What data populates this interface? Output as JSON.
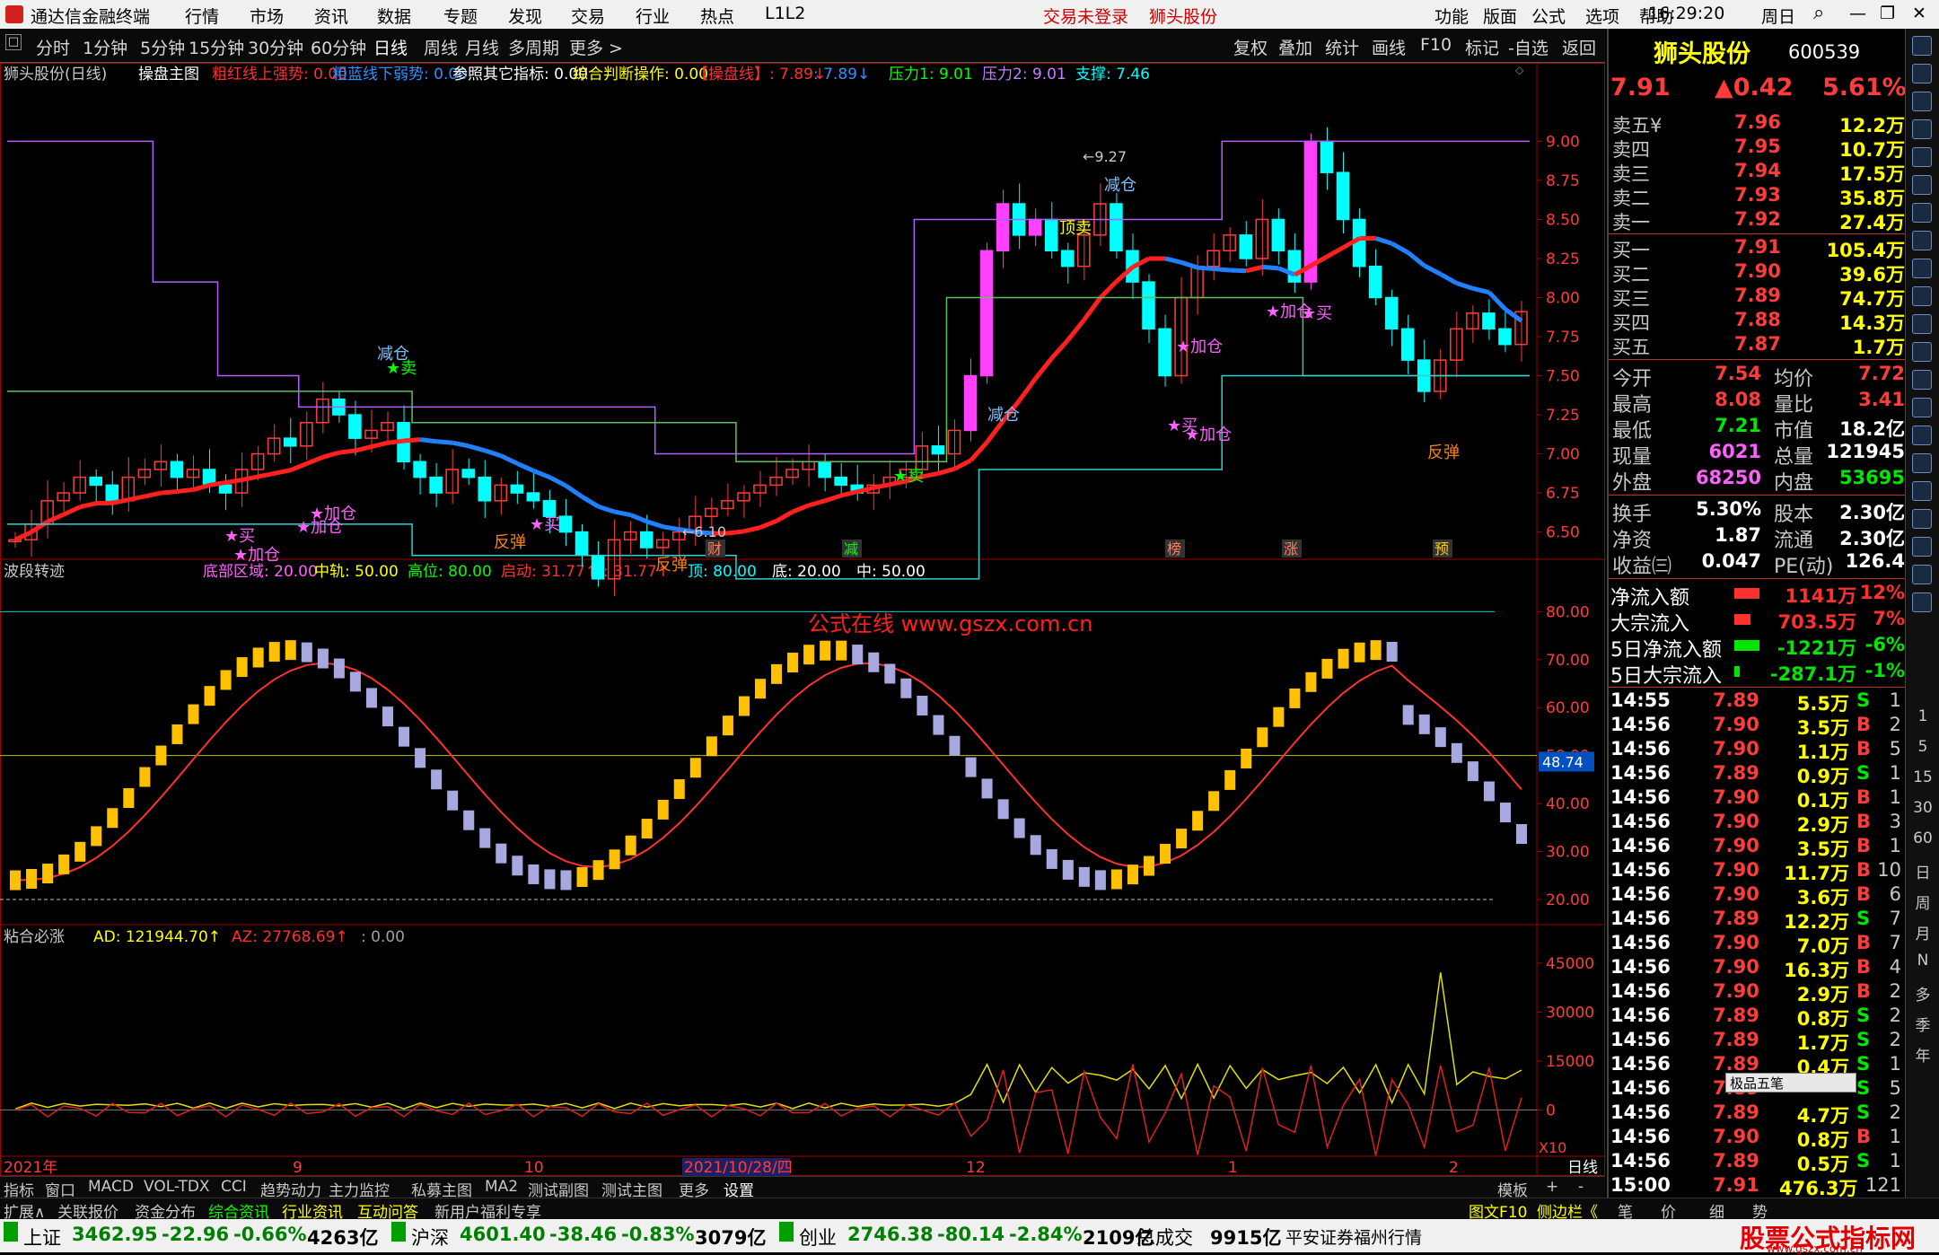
{
  "app": {
    "title": "通达信金融终端",
    "menu": [
      "行情",
      "市场",
      "资讯",
      "数据",
      "专题",
      "发现",
      "交易",
      "行业",
      "热点",
      "L1L2"
    ],
    "login": "交易未登录",
    "stock_name": "狮头股份",
    "right_menu": [
      "功能",
      "版面",
      "公式",
      "选项",
      "帮助"
    ],
    "time": "16:29:20",
    "weekday": "周日"
  },
  "toolbar": {
    "periods": [
      "分时",
      "1分钟",
      "5分钟",
      "15分钟",
      "30分钟",
      "60分钟",
      "日线",
      "周线",
      "月线",
      "多周期",
      "更多 >"
    ],
    "right": [
      "复权",
      "叠加",
      "统计",
      "画线",
      "F10",
      "标记",
      "-自选",
      "返回"
    ]
  },
  "main_panel": {
    "name": "狮头股份(日线)",
    "indicator": "操盘主图",
    "items": [
      {
        "t": "粗红线上强势: 0.00",
        "c": "#ff3030"
      },
      {
        "t": "粗蓝线下弱势: 0.00",
        "c": "#3090ff"
      },
      {
        "t": "参照其它指标: 0.00",
        "c": "#ffffff"
      },
      {
        "t": "综合判断操作: 0.00",
        "c": "#ffff00"
      },
      {
        "t": "【操盘线】: 7.89↓",
        "c": "#ff3030"
      },
      {
        "t": ": 7.89↓",
        "c": "#3090ff"
      },
      {
        "t": "压力1: 9.01",
        "c": "#00ff00"
      },
      {
        "t": "压力2: 9.01",
        "c": "#c080ff"
      },
      {
        "t": "支撑: 7.46",
        "c": "#00ffff"
      }
    ],
    "yticks": [
      "9.00",
      "8.75",
      "8.50",
      "8.25",
      "8.00",
      "7.75",
      "7.50",
      "7.25",
      "7.00",
      "6.75",
      "6.50"
    ],
    "high_label": "9.27",
    "low_label": "6.10",
    "signals": [
      {
        "t": "减仓",
        "c": "#80c0ff"
      },
      {
        "t": "★卖",
        "c": "#00ff00"
      },
      {
        "t": "减仓",
        "c": "#80c0ff"
      },
      {
        "t": "减仓",
        "c": "#80c0ff"
      },
      {
        "t": "顶卖",
        "c": "#ffff00"
      },
      {
        "t": "★卖",
        "c": "#00ff00"
      },
      {
        "t": "★买",
        "c": "#ff60ff"
      },
      {
        "t": "★加仓",
        "c": "#ff60ff"
      },
      {
        "t": "★加仓",
        "c": "#ff60ff"
      },
      {
        "t": "★加仓",
        "c": "#ff60ff"
      },
      {
        "t": "反弹",
        "c": "#ff8000"
      },
      {
        "t": "反弹",
        "c": "#ff8000"
      },
      {
        "t": "★买",
        "c": "#ff60ff"
      },
      {
        "t": "★加仓",
        "c": "#ff60ff"
      },
      {
        "t": "★买",
        "c": "#ff60ff"
      },
      {
        "t": "★加仓",
        "c": "#ff60ff"
      },
      {
        "t": "★加仓",
        "c": "#ff60ff"
      },
      {
        "t": "★买",
        "c": "#ff60ff"
      },
      {
        "t": "反弹",
        "c": "#ff8000"
      }
    ],
    "badges": [
      "财",
      "减",
      "榜",
      "涨",
      "预"
    ]
  },
  "wave_panel": {
    "name": "波段转迹",
    "items": [
      {
        "t": "底部区域: 20.00",
        "c": "#ff60ff"
      },
      {
        "t": "中轨: 50.00",
        "c": "#ffff00"
      },
      {
        "t": "高位: 80.00",
        "c": "#00ff00"
      },
      {
        "t": "启动: 31.77↑",
        "c": "#ff3030"
      },
      {
        "t": ": 31.77↑",
        "c": "#ff3030"
      },
      {
        "t": "顶: 80.00",
        "c": "#00ffff"
      },
      {
        "t": "底: 20.00",
        "c": "#ffffff"
      },
      {
        "t": "中: 50.00",
        "c": "#ffffff"
      }
    ],
    "yticks": [
      "80.00",
      "70.00",
      "60.00",
      "50.00",
      "40.00",
      "30.00",
      "20.00"
    ],
    "marker": "48.74",
    "watermark": "公式在线  www.gszx.com.cn"
  },
  "ad_panel": {
    "name": "粘合必涨",
    "items": [
      {
        "t": "AD: 121944.70↑",
        "c": "#ffff00"
      },
      {
        "t": "AZ: 27768.69↑",
        "c": "#ff3030"
      },
      {
        "t": ": 0.00",
        "c": "#a0a0a0"
      }
    ],
    "yticks": [
      "45000",
      "30000",
      "15000",
      "0"
    ],
    "x10": "X10"
  },
  "xaxis": {
    "labels": [
      "2021年",
      "9",
      "10",
      "2021/10/28/四",
      "12",
      "1",
      "2",
      "日线"
    ]
  },
  "chart_data": {
    "type": "candlestick",
    "ohlc_close_series": [
      6.45,
      6.55,
      6.7,
      6.75,
      6.85,
      6.8,
      6.7,
      6.85,
      6.9,
      6.95,
      6.85,
      6.9,
      6.8,
      6.75,
      6.9,
      7.0,
      7.1,
      7.05,
      7.2,
      7.35,
      7.25,
      7.1,
      7.15,
      7.2,
      6.95,
      6.85,
      6.75,
      6.9,
      6.85,
      6.7,
      6.8,
      6.75,
      6.7,
      6.6,
      6.5,
      6.35,
      6.2,
      6.45,
      6.5,
      6.4,
      6.45,
      6.5,
      6.6,
      6.65,
      6.7,
      6.75,
      6.8,
      6.85,
      6.9,
      6.95,
      6.85,
      6.8,
      6.75,
      6.8,
      6.85,
      6.9,
      7.05,
      7.0,
      7.15,
      7.5,
      8.3,
      8.6,
      8.4,
      8.5,
      8.3,
      8.2,
      8.4,
      8.6,
      8.3,
      8.1,
      7.8,
      7.5,
      8.0,
      8.2,
      8.3,
      8.4,
      8.25,
      8.5,
      8.3,
      8.1,
      9.0,
      8.8,
      8.5,
      8.2,
      8.0,
      7.8,
      7.6,
      7.4,
      7.6,
      7.8,
      7.9,
      7.8,
      7.7,
      7.91
    ]
  },
  "quote": {
    "name": "狮头股份",
    "code": "600539",
    "price": "7.91",
    "change": "▲0.42",
    "pct": "5.61%",
    "asks": [
      {
        "l": "卖五¥",
        "p": "7.96",
        "v": "12.2万"
      },
      {
        "l": "卖四",
        "p": "7.95",
        "v": "10.7万"
      },
      {
        "l": "卖三",
        "p": "7.94",
        "v": "17.5万"
      },
      {
        "l": "卖二",
        "p": "7.93",
        "v": "35.8万"
      },
      {
        "l": "卖一",
        "p": "7.92",
        "v": "27.4万"
      }
    ],
    "bids": [
      {
        "l": "买一",
        "p": "7.91",
        "v": "105.4万"
      },
      {
        "l": "买二",
        "p": "7.90",
        "v": "39.6万"
      },
      {
        "l": "买三",
        "p": "7.89",
        "v": "74.7万"
      },
      {
        "l": "买四",
        "p": "7.88",
        "v": "14.3万"
      },
      {
        "l": "买五",
        "p": "7.87",
        "v": "1.7万"
      }
    ],
    "stats": [
      [
        "今开",
        "7.54",
        "均价",
        "7.72"
      ],
      [
        "最高",
        "8.08",
        "量比",
        "3.41"
      ],
      [
        "最低",
        "7.21",
        "市值",
        "18.2亿"
      ],
      [
        "现量",
        "6021",
        "总量",
        "121945"
      ],
      [
        "外盘",
        "68250",
        "内盘",
        "53695"
      ]
    ],
    "stats2": [
      [
        "换手",
        "5.30%",
        "股本",
        "2.30亿"
      ],
      [
        "净资",
        "1.87",
        "流通",
        "2.30亿"
      ],
      [
        "收益㈢",
        "0.047",
        "PE(动)",
        "126.4"
      ]
    ],
    "flow": [
      {
        "l": "净流入额",
        "v": "1141万",
        "p": "12%",
        "c": "#ff3030"
      },
      {
        "l": "大宗流入",
        "v": "703.5万",
        "p": "7%",
        "c": "#ff3030"
      },
      {
        "l": "5日净流入额",
        "v": "-1221万",
        "p": "-6%",
        "c": "#00e600"
      },
      {
        "l": "5日大宗流入",
        "v": "-287.1万",
        "p": "-1%",
        "c": "#00e600"
      }
    ],
    "ticks": [
      [
        "14:55",
        "7.89",
        "5.5万",
        "S",
        "1"
      ],
      [
        "14:56",
        "7.90",
        "3.5万",
        "B",
        "2"
      ],
      [
        "14:56",
        "7.90",
        "1.1万",
        "B",
        "5"
      ],
      [
        "14:56",
        "7.89",
        "0.9万",
        "S",
        "1"
      ],
      [
        "14:56",
        "7.90",
        "0.1万",
        "B",
        "1"
      ],
      [
        "14:56",
        "7.90",
        "2.9万",
        "B",
        "3"
      ],
      [
        "14:56",
        "7.90",
        "3.5万",
        "B",
        "1"
      ],
      [
        "14:56",
        "7.90",
        "11.7万",
        "B",
        "10"
      ],
      [
        "14:56",
        "7.90",
        "3.6万",
        "B",
        "6"
      ],
      [
        "14:56",
        "7.89",
        "12.2万",
        "S",
        "7"
      ],
      [
        "14:56",
        "7.90",
        "7.0万",
        "B",
        "7"
      ],
      [
        "14:56",
        "7.90",
        "16.3万",
        "B",
        "4"
      ],
      [
        "14:56",
        "7.90",
        "2.9万",
        "B",
        "2"
      ],
      [
        "14:56",
        "7.89",
        "0.8万",
        "S",
        "2"
      ],
      [
        "14:56",
        "7.89",
        "1.7万",
        "S",
        "2"
      ],
      [
        "14:56",
        "7.89",
        "0.4万",
        "S",
        "1"
      ],
      [
        "14:56",
        "7.89",
        "",
        "S",
        "5"
      ],
      [
        "14:56",
        "7.89",
        "4.7万",
        "S",
        "2"
      ],
      [
        "14:56",
        "7.90",
        "0.8万",
        "B",
        "1"
      ],
      [
        "14:56",
        "7.89",
        "0.5万",
        "S",
        "1"
      ],
      [
        "15:00",
        "7.91",
        "476.3万",
        "",
        "121"
      ]
    ],
    "ime": "极品五笔"
  },
  "sidebar_labels": [
    "1",
    "5",
    "15",
    "30",
    "60",
    "日",
    "周",
    "月",
    "N",
    "多",
    "季",
    "年"
  ],
  "bottom1": [
    "指标",
    "窗口",
    "MACD",
    "VOL-TDX",
    "CCI",
    "趋势动力",
    "主力监控",
    "私募主图",
    "MA2",
    "测试副图",
    "测试主图",
    "更多",
    "设置"
  ],
  "bottom1_right": [
    "模板",
    "+",
    "-"
  ],
  "bottom2": [
    "扩展∧",
    "关联报价",
    "资金分布",
    "综合资讯",
    "行业资讯",
    "互动问答",
    "新用户福利专享"
  ],
  "bottom2_right": [
    "图文F10",
    "侧边栏《",
    "笔",
    "价",
    "细",
    "势"
  ],
  "status": [
    {
      "n": "上证",
      "v": "3462.95",
      "c": "-22.96",
      "p": "-0.66%",
      "a": "4263亿"
    },
    {
      "n": "沪深",
      "v": "4601.40",
      "c": "-38.46",
      "p": "-0.83%",
      "a": "3079亿"
    },
    {
      "n": "创业",
      "v": "2746.38",
      "c": "-80.14",
      "p": "-2.84%",
      "a": "2109亿"
    }
  ],
  "status_total": {
    "l": "总成交",
    "v": "9915亿"
  },
  "status_broker": "平安证券福州行情",
  "watermark2": "股票公式指标网",
  "watermark2_url": "www.gszx.com.cn"
}
